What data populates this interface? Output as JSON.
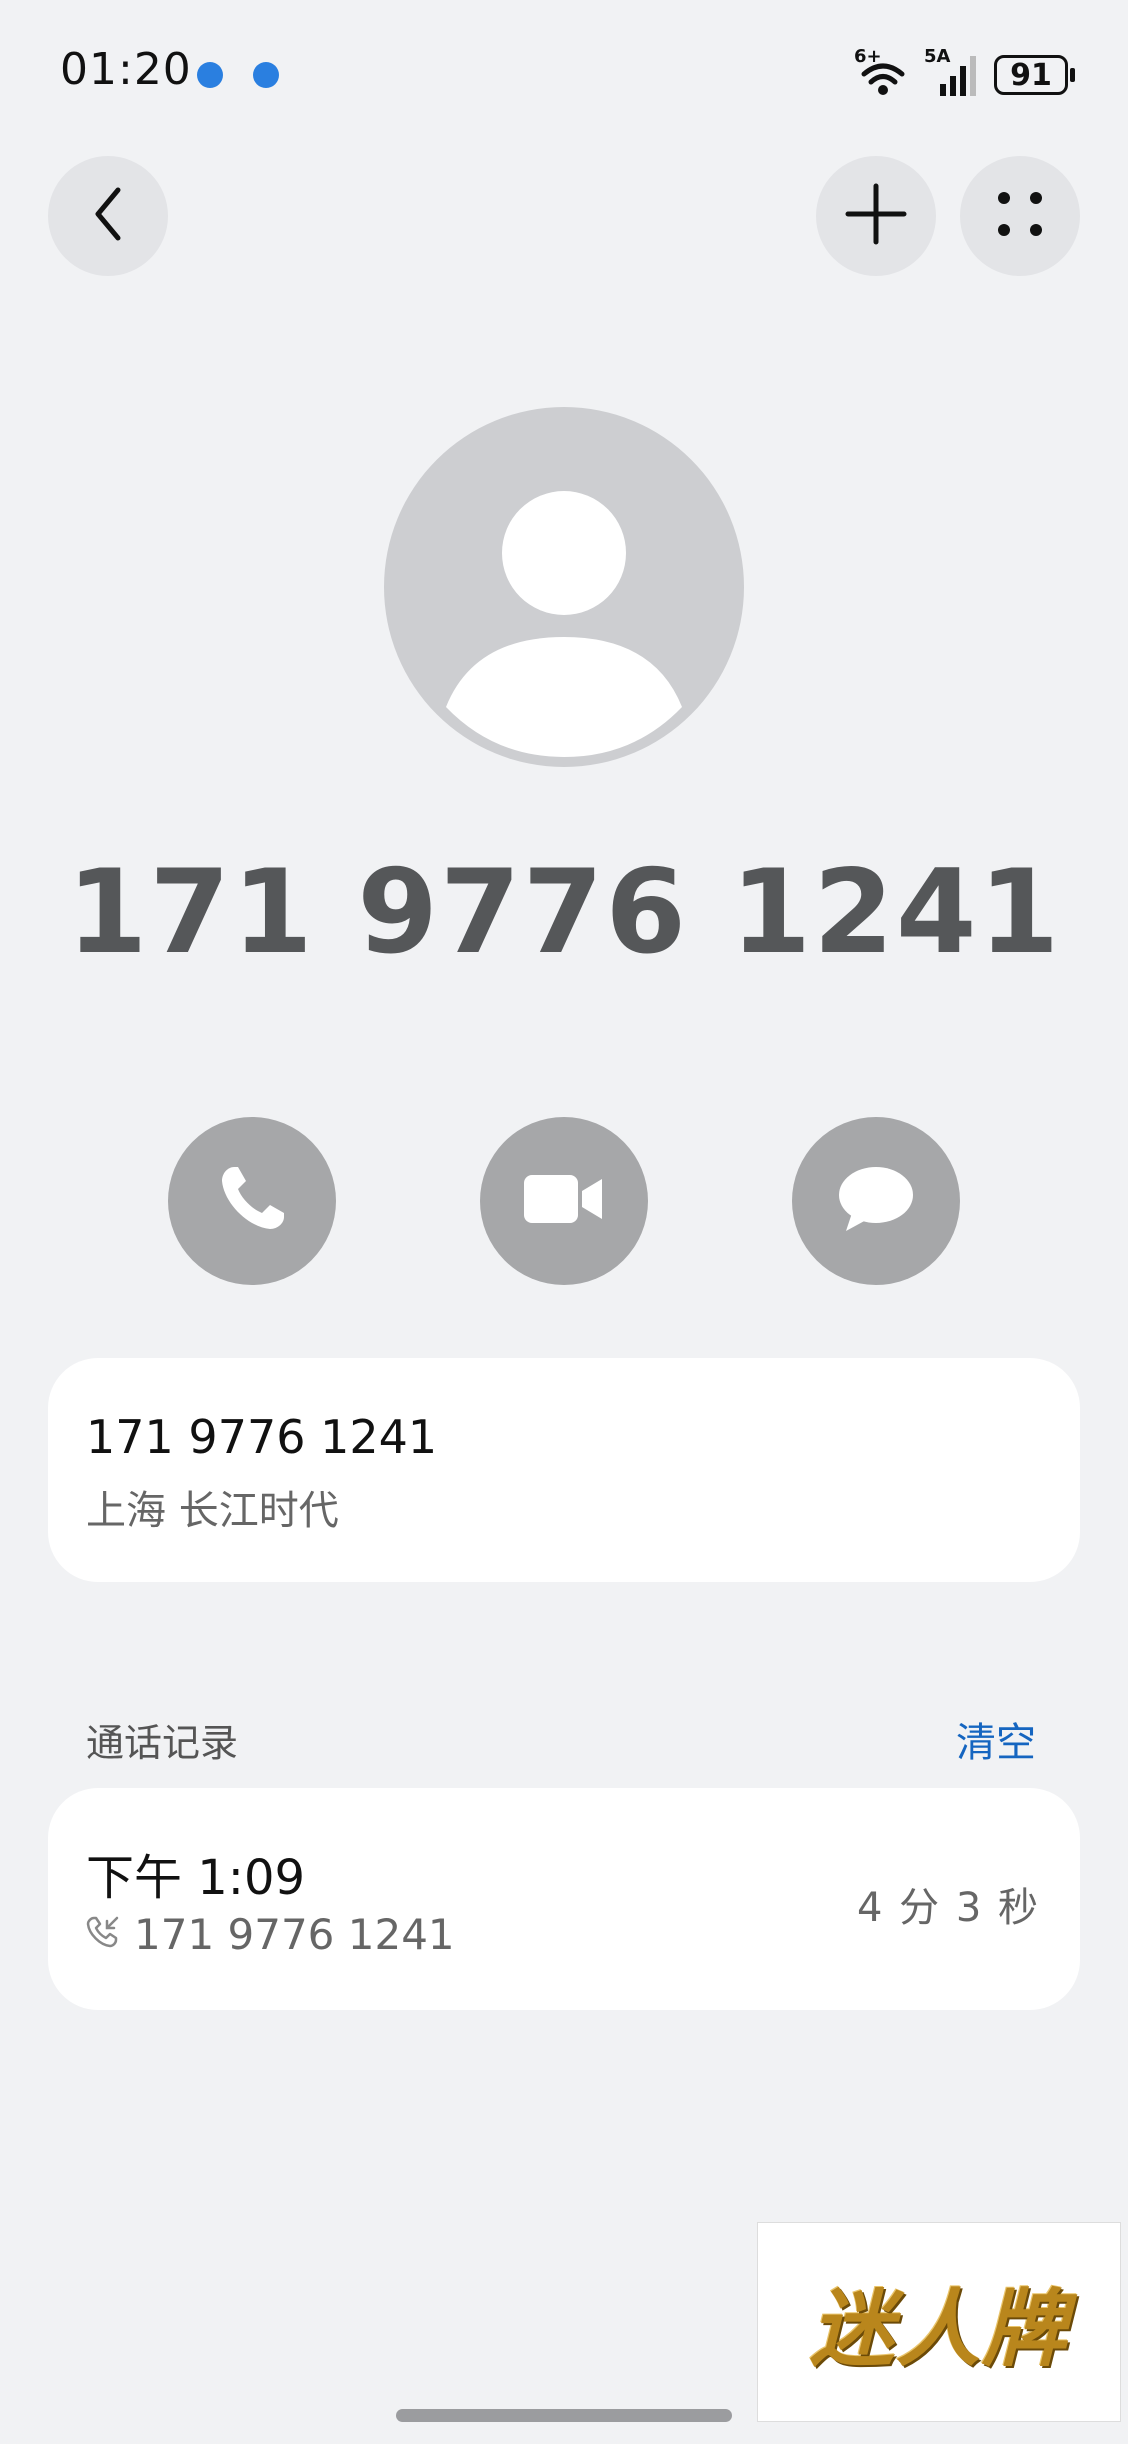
{
  "status_bar": {
    "time": "01:20",
    "network_wifi_label": "6+",
    "network_cell_label": "5A",
    "battery": "91"
  },
  "contact": {
    "number": "171 9776 1241"
  },
  "info_card": {
    "number": "171 9776 1241",
    "location": "上海 长江时代"
  },
  "call_log": {
    "title": "通话记录",
    "clear_label": "清空",
    "records": [
      {
        "time": "下午 1:09",
        "number": "171 9776 1241",
        "duration": "4 分 3 秒"
      }
    ]
  },
  "watermark": {
    "text": "迷人牌"
  },
  "colors": {
    "background": "#f1f2f4",
    "accent": "#1565c0",
    "action_button": "#a6a7a9",
    "avatar": "#cdced1"
  },
  "icons": {
    "back": "back-arrow-icon",
    "add": "plus-icon",
    "more": "four-dots-icon",
    "call": "phone-icon",
    "video": "video-camera-icon",
    "message": "chat-bubble-icon",
    "incoming_call": "incoming-call-icon"
  }
}
